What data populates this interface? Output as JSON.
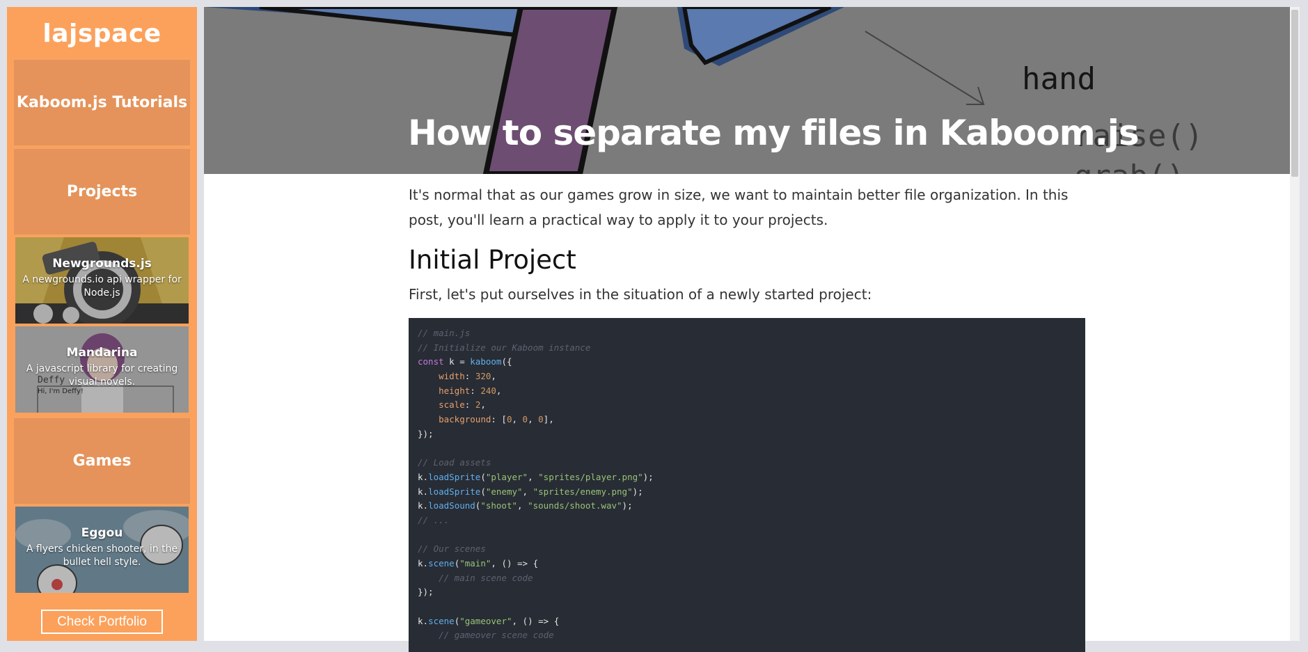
{
  "sidebar": {
    "brand": "lajspace",
    "nav": {
      "tutorials": "Kaboom.js Tutorials",
      "projects": "Projects",
      "games": "Games"
    },
    "projects": [
      {
        "title": "Newgrounds.js",
        "desc": "A newgrounds.io api wrapper for Node.js"
      },
      {
        "title": "Mandarina",
        "desc": "A javascript library for creating visual novels.",
        "image_text": [
          "Deffy",
          "Hi, I'm Deffy!"
        ]
      }
    ],
    "games": [
      {
        "title": "Eggou",
        "desc": "A flyers chicken shooter, in the bullet hell style."
      }
    ],
    "portfolio_button": "Check Portfolio",
    "colors": {
      "sidebar": "#fca15b",
      "block": "#e5935a"
    }
  },
  "hero": {
    "title": "How to separate my files in Kaboom.js",
    "image_text": [
      "hand",
      "raise()",
      "grab()"
    ]
  },
  "article": {
    "intro": "It's normal that as our games grow in size, we want to maintain better file organization. In this post, you'll learn a practical way to apply it to your projects.",
    "section_title": "Initial Project",
    "section_intro": "First, let's put ourselves in the situation of a newly started project:",
    "code_lines": [
      [
        {
          "t": "// main.js",
          "c": "c-com"
        }
      ],
      [
        {
          "t": "// Initialize our Kaboom instance",
          "c": "c-com"
        }
      ],
      [
        {
          "t": "const",
          "c": "c-kw"
        },
        {
          "t": " k = ",
          "c": "c-plain"
        },
        {
          "t": "kaboom",
          "c": "c-fn"
        },
        {
          "t": "({",
          "c": "c-plain"
        }
      ],
      [
        {
          "t": "    ",
          "c": "c-plain"
        },
        {
          "t": "width",
          "c": "c-prop"
        },
        {
          "t": ": ",
          "c": "c-plain"
        },
        {
          "t": "320",
          "c": "c-num"
        },
        {
          "t": ",",
          "c": "c-plain"
        }
      ],
      [
        {
          "t": "    ",
          "c": "c-plain"
        },
        {
          "t": "height",
          "c": "c-prop"
        },
        {
          "t": ": ",
          "c": "c-plain"
        },
        {
          "t": "240",
          "c": "c-num"
        },
        {
          "t": ",",
          "c": "c-plain"
        }
      ],
      [
        {
          "t": "    ",
          "c": "c-plain"
        },
        {
          "t": "scale",
          "c": "c-prop"
        },
        {
          "t": ": ",
          "c": "c-plain"
        },
        {
          "t": "2",
          "c": "c-num"
        },
        {
          "t": ",",
          "c": "c-plain"
        }
      ],
      [
        {
          "t": "    ",
          "c": "c-plain"
        },
        {
          "t": "background",
          "c": "c-prop"
        },
        {
          "t": ": [",
          "c": "c-plain"
        },
        {
          "t": "0",
          "c": "c-num"
        },
        {
          "t": ", ",
          "c": "c-plain"
        },
        {
          "t": "0",
          "c": "c-num"
        },
        {
          "t": ", ",
          "c": "c-plain"
        },
        {
          "t": "0",
          "c": "c-num"
        },
        {
          "t": "],",
          "c": "c-plain"
        }
      ],
      [
        {
          "t": "});",
          "c": "c-plain"
        }
      ],
      [
        {
          "t": "",
          "c": "c-plain"
        }
      ],
      [
        {
          "t": "// Load assets",
          "c": "c-com"
        }
      ],
      [
        {
          "t": "k.",
          "c": "c-plain"
        },
        {
          "t": "loadSprite",
          "c": "c-fn"
        },
        {
          "t": "(",
          "c": "c-plain"
        },
        {
          "t": "\"player\"",
          "c": "c-str"
        },
        {
          "t": ", ",
          "c": "c-plain"
        },
        {
          "t": "\"sprites/player.png\"",
          "c": "c-str"
        },
        {
          "t": ");",
          "c": "c-plain"
        }
      ],
      [
        {
          "t": "k.",
          "c": "c-plain"
        },
        {
          "t": "loadSprite",
          "c": "c-fn"
        },
        {
          "t": "(",
          "c": "c-plain"
        },
        {
          "t": "\"enemy\"",
          "c": "c-str"
        },
        {
          "t": ", ",
          "c": "c-plain"
        },
        {
          "t": "\"sprites/enemy.png\"",
          "c": "c-str"
        },
        {
          "t": ");",
          "c": "c-plain"
        }
      ],
      [
        {
          "t": "k.",
          "c": "c-plain"
        },
        {
          "t": "loadSound",
          "c": "c-fn"
        },
        {
          "t": "(",
          "c": "c-plain"
        },
        {
          "t": "\"shoot\"",
          "c": "c-str"
        },
        {
          "t": ", ",
          "c": "c-plain"
        },
        {
          "t": "\"sounds/shoot.wav\"",
          "c": "c-str"
        },
        {
          "t": ");",
          "c": "c-plain"
        }
      ],
      [
        {
          "t": "// ...",
          "c": "c-com"
        }
      ],
      [
        {
          "t": "",
          "c": "c-plain"
        }
      ],
      [
        {
          "t": "// Our scenes",
          "c": "c-com"
        }
      ],
      [
        {
          "t": "k.",
          "c": "c-plain"
        },
        {
          "t": "scene",
          "c": "c-fn"
        },
        {
          "t": "(",
          "c": "c-plain"
        },
        {
          "t": "\"main\"",
          "c": "c-str"
        },
        {
          "t": ", () => {",
          "c": "c-plain"
        }
      ],
      [
        {
          "t": "    ",
          "c": "c-plain"
        },
        {
          "t": "// main scene code",
          "c": "c-com"
        }
      ],
      [
        {
          "t": "});",
          "c": "c-plain"
        }
      ],
      [
        {
          "t": "",
          "c": "c-plain"
        }
      ],
      [
        {
          "t": "k.",
          "c": "c-plain"
        },
        {
          "t": "scene",
          "c": "c-fn"
        },
        {
          "t": "(",
          "c": "c-plain"
        },
        {
          "t": "\"gameover\"",
          "c": "c-str"
        },
        {
          "t": ", () => {",
          "c": "c-plain"
        }
      ],
      [
        {
          "t": "    ",
          "c": "c-plain"
        },
        {
          "t": "// gameover scene code",
          "c": "c-com"
        }
      ]
    ]
  }
}
